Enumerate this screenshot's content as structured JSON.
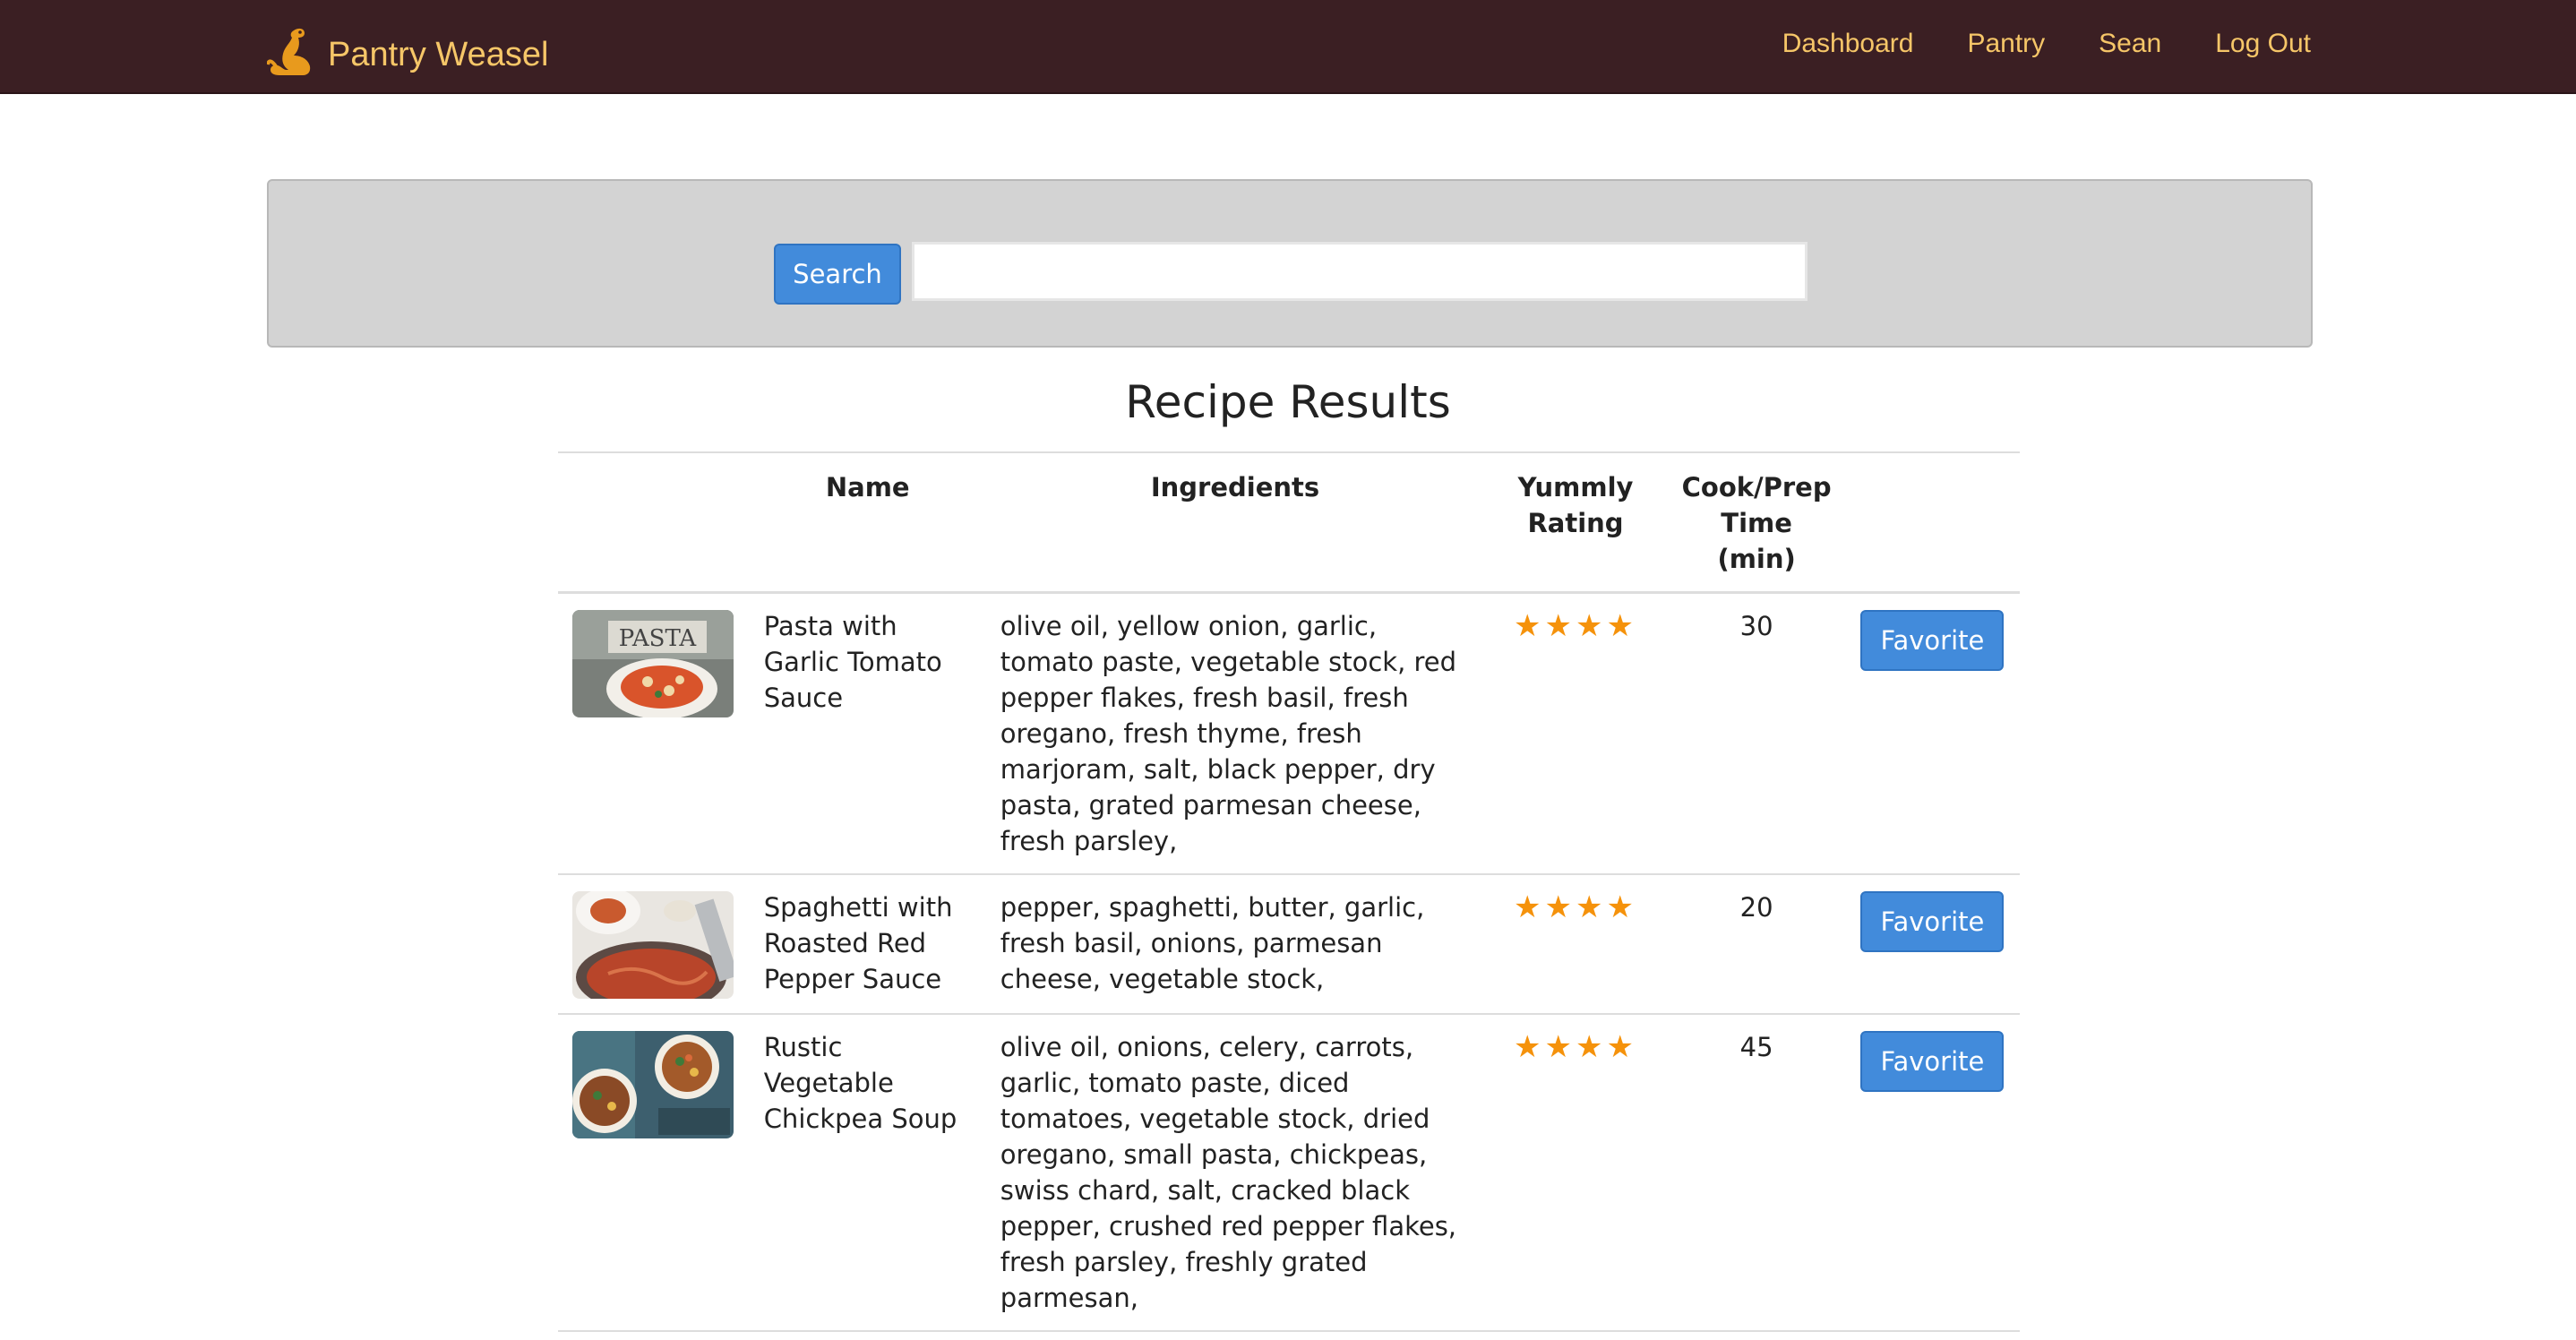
{
  "navbar": {
    "brand": "Pantry Weasel",
    "brand_icon": "weasel-logo-icon",
    "brand_color": "#f6c668",
    "background": "#3b1f23",
    "links": [
      "Dashboard",
      "Pantry",
      "Sean",
      "Log Out"
    ]
  },
  "search": {
    "button_label": "Search",
    "input_value": "",
    "placeholder": ""
  },
  "results": {
    "title": "Recipe Results",
    "columns": {
      "name": "Name",
      "ingredients": "Ingredients",
      "rating": "Yummly Rating",
      "time": "Cook/Prep Time (min)"
    },
    "rows": [
      {
        "image": "pasta-photo",
        "name": "Pasta with Garlic Tomato Sauce",
        "ingredients": "olive oil, yellow onion, garlic, tomato paste, vegetable stock, red pepper flakes, fresh basil, fresh oregano, fresh thyme, fresh marjoram, salt, black pepper, dry pasta, grated parmesan cheese, fresh parsley,",
        "rating": 4,
        "rating_stars": "★★★★",
        "time": "30",
        "button_label": "Favorite"
      },
      {
        "image": "spaghetti-photo",
        "name": "Spaghetti with Roasted Red Pepper Sauce",
        "ingredients": "pepper, spaghetti, butter, garlic, fresh basil, onions, parmesan cheese, vegetable stock,",
        "rating": 4,
        "rating_stars": "★★★★",
        "time": "20",
        "button_label": "Favorite"
      },
      {
        "image": "soup-photo",
        "name": "Rustic Vegetable Chickpea Soup",
        "ingredients": "olive oil, onions, celery, carrots, garlic, tomato paste, diced tomatoes, vegetable stock, dried oregano, small pasta, chickpeas, swiss chard, salt, cracked black pepper, crushed red pepper flakes, fresh parsley, freshly grated parmesan,",
        "rating": 4,
        "rating_stars": "★★★★",
        "time": "45",
        "button_label": "Favorite"
      }
    ]
  },
  "colors": {
    "primary_button": "#428bdb",
    "star": "#f5920b",
    "panel": "#d3d3d3"
  }
}
